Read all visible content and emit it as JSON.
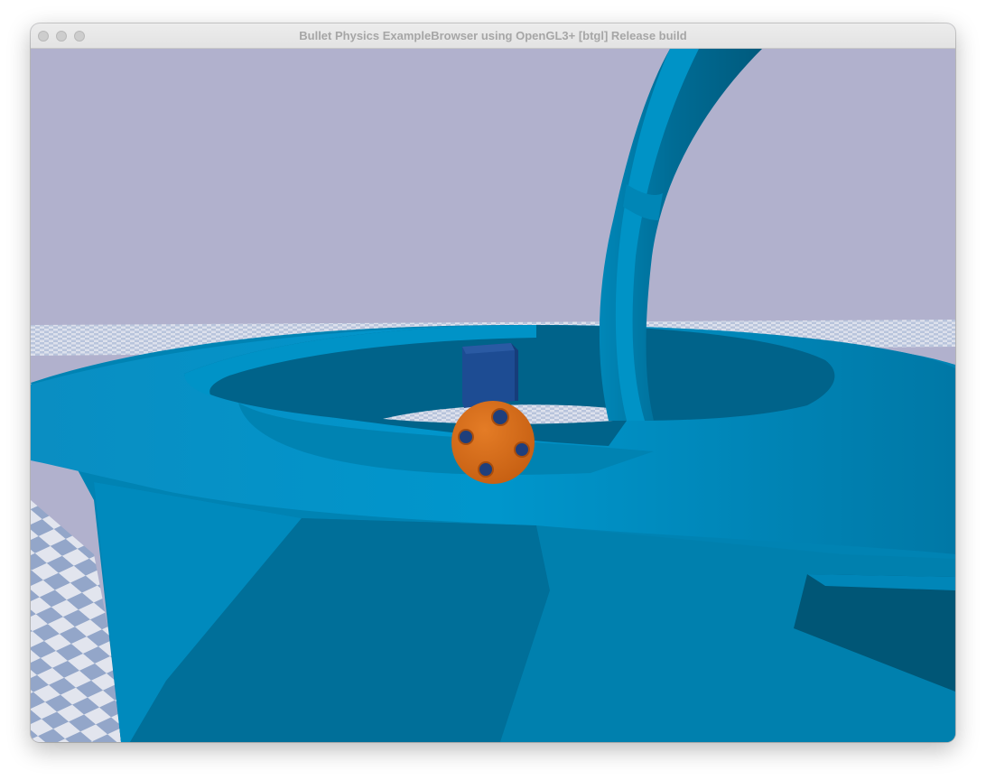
{
  "window": {
    "title": "Bullet Physics ExampleBrowser using OpenGL3+ [btgl] Release build",
    "controls": [
      "close",
      "minimize",
      "zoom"
    ]
  },
  "scene": {
    "background_color": "#b1b1cd",
    "ground_light": "#dfe3ee",
    "ground_dark": "#8fa3c8",
    "ring_color": "#0090c4",
    "ring_shadow_color": "#006a93",
    "arch_color": "#0082b0",
    "box_color": "#1c4a92",
    "ball_color": "#d2691a",
    "objects": [
      "checkered-ground",
      "blue-ring-track",
      "blue-arch",
      "blue-box",
      "orange-wiffle-ball"
    ]
  },
  "colors": {
    "titlebar": "#e8e8e8",
    "title_text": "#a6a6a6",
    "traffic_inactive": "#cdcdcd"
  }
}
